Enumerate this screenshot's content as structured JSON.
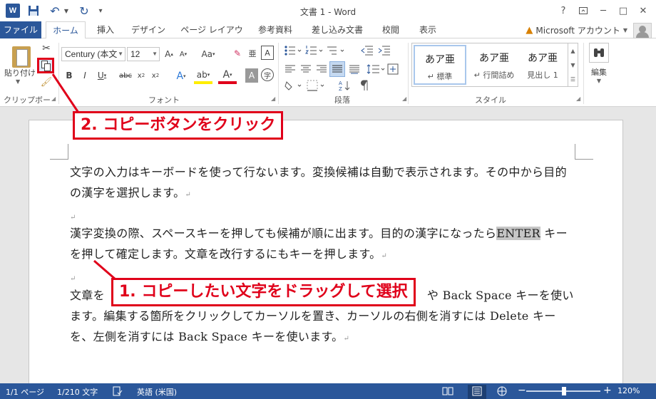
{
  "titlebar": {
    "app_icon": "W",
    "title": "文書 1 - Word",
    "help": "?",
    "minimize": "─",
    "maximize": "□",
    "close": "✕"
  },
  "tabs": {
    "file": "ファイル",
    "home": "ホーム",
    "insert": "挿入",
    "design": "デザイン",
    "layout": "ページ レイアウト",
    "references": "参考資料",
    "mailings": "差し込み文書",
    "review": "校閲",
    "view": "表示",
    "account": "Microsoft アカウント"
  },
  "ribbon": {
    "paste_label": "貼り付け",
    "clipboard_group": "クリップボード",
    "font_name": "Century (本文",
    "font_size": "12",
    "font_group": "フォント",
    "paragraph_group": "段落",
    "styles": [
      {
        "sample": "あア亜",
        "name": "↵ 標準"
      },
      {
        "sample": "あア亜",
        "name": "↵ 行間詰め"
      },
      {
        "sample": "あア亜",
        "name": "見出し 1"
      }
    ],
    "styles_group": "スタイル",
    "editing_label": "編集"
  },
  "document": {
    "p1": "文字の入力はキーボードを使って行ないます。変換候補は自動で表示されます。その中から目的の漢字を選択します。",
    "p2a": "漢字変換の際、スペースキーを押しても候補が順に出ます。目的の漢字になったら",
    "p2_selected": "ENTER",
    "p2b": " キーを押して確定します。文章を改行するにもキーを押します。",
    "p3a": "文章を",
    "p3b": "や Back Space キーを使います。編集する箇所をクリックしてカーソルを置き、カーソルの右側を消すには Delete キーを、左側を消すには Back Space キーを使います。"
  },
  "callouts": {
    "step1": "1. コピーしたい文字をドラッグして選択",
    "step2": "2. コピーボタンをクリック"
  },
  "status": {
    "page": "1/1 ページ",
    "words": "1/210 文字",
    "language": "英語 (米国)",
    "zoom_minus": "−",
    "zoom_plus": "+",
    "zoom": "120%"
  },
  "colors": {
    "word_blue": "#2b579a",
    "callout_red": "#e0001a",
    "selection_gray": "#c6c6c6"
  }
}
